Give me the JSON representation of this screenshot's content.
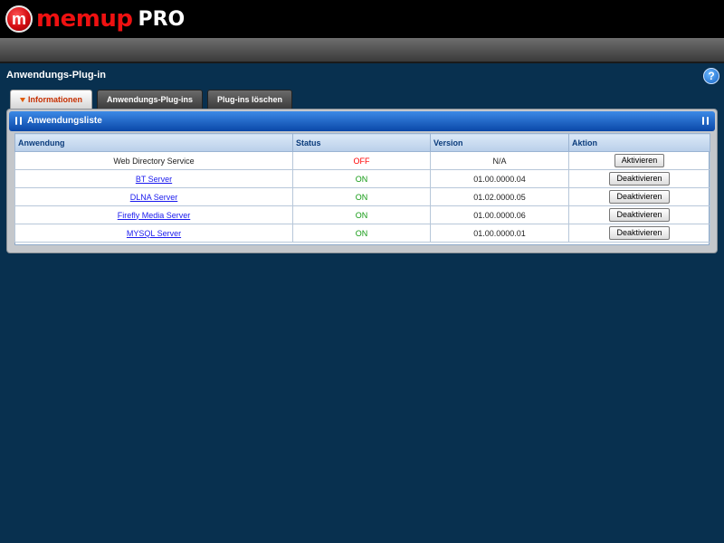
{
  "header": {
    "logo_badge": "m",
    "logo_text": "memup",
    "logo_pro": "PRO"
  },
  "page": {
    "title": "Anwendungs-Plug-in",
    "help_label": "?"
  },
  "tabs": [
    {
      "label": "Informationen",
      "active": true
    },
    {
      "label": "Anwendungs-Plug-ins",
      "active": false
    },
    {
      "label": "Plug-ins löschen",
      "active": false
    }
  ],
  "panel": {
    "title": "Anwendungsliste"
  },
  "table": {
    "columns": [
      "Anwendung",
      "Status",
      "Version",
      "Aktion"
    ],
    "rows": [
      {
        "name": "Web Directory Service",
        "link": false,
        "status": "OFF",
        "version": "N/A",
        "action": "Aktivieren"
      },
      {
        "name": "BT Server",
        "link": true,
        "status": "ON",
        "version": "01.00.0000.04",
        "action": "Deaktivieren"
      },
      {
        "name": "DLNA Server",
        "link": true,
        "status": "ON",
        "version": "01.02.0000.05",
        "action": "Deaktivieren"
      },
      {
        "name": "Firefly Media Server",
        "link": true,
        "status": "ON",
        "version": "01.00.0000.06",
        "action": "Deaktivieren"
      },
      {
        "name": "MYSQL Server",
        "link": true,
        "status": "ON",
        "version": "01.00.0000.01",
        "action": "Deaktivieren"
      }
    ]
  },
  "colors": {
    "background": "#08304f",
    "status_on": "#119911",
    "status_off": "#ff0000",
    "accent": "#0a47a8"
  },
  "icons": {
    "help": "help-icon",
    "grip": "grip-icon",
    "tab_active": "arrow-down-icon"
  }
}
